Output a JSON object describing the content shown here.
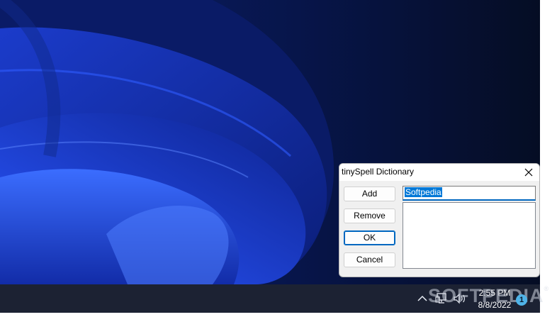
{
  "dialog": {
    "title": "tinySpell Dictionary",
    "buttons": {
      "add": "Add",
      "remove": "Remove",
      "ok": "OK",
      "cancel": "Cancel"
    },
    "word_input_value": "Softpedia",
    "word_list_items": []
  },
  "taskbar": {
    "time": "2:55 PM",
    "date": "8/8/2022",
    "notification_count": "1",
    "tray_icons": [
      "chevron-up-icon",
      "network-icon",
      "volume-icon"
    ]
  },
  "watermark": {
    "text": "SOFTPEDIA",
    "mark": "®"
  },
  "colors": {
    "accent": "#0067c0",
    "selection": "#0078d7",
    "taskbar": "#1c2233",
    "desktop": "#06102a"
  }
}
